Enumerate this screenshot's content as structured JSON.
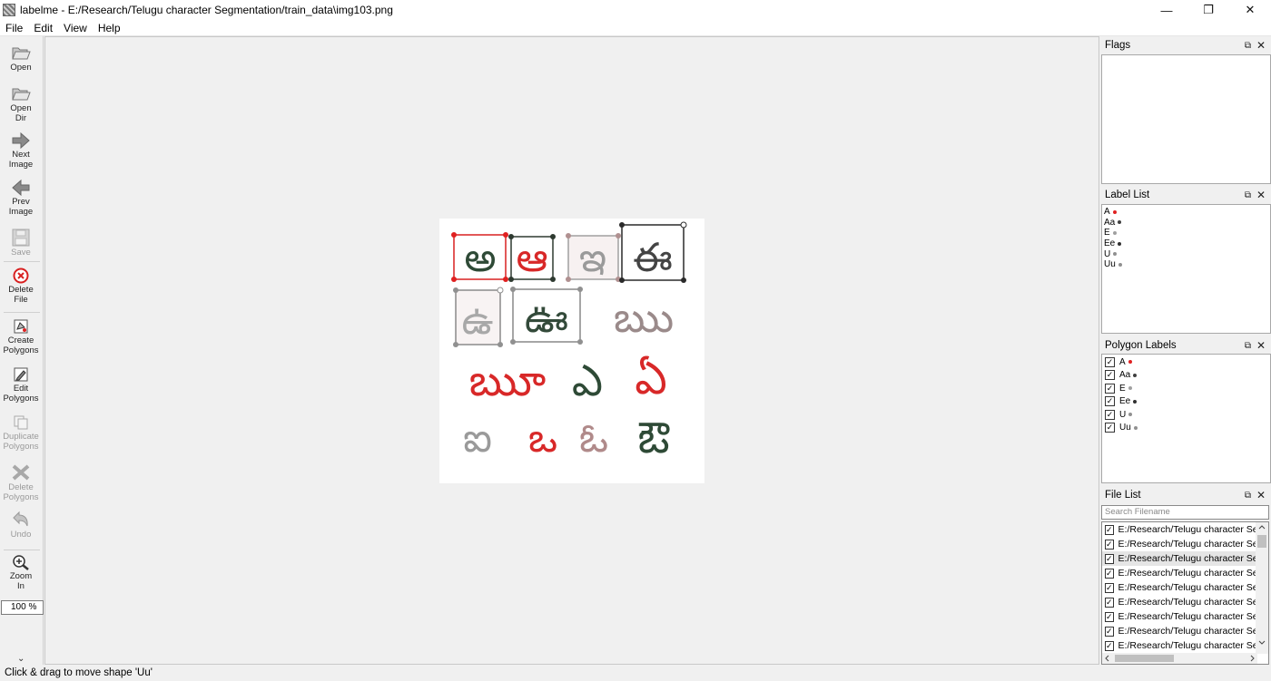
{
  "window": {
    "title": "labelme - E:/Research/Telugu character Segmentation/train_data\\img103.png",
    "minimize": "—",
    "restore": "❐",
    "close": "✕"
  },
  "menu": [
    "File",
    "Edit",
    "View",
    "Help"
  ],
  "toolbar": {
    "open": "Open",
    "open_dir": "Open\nDir",
    "next_image": "Next\nImage",
    "prev_image": "Prev\nImage",
    "save": "Save",
    "delete_file": "Delete\nFile",
    "create_polygons": "Create\nPolygons",
    "edit_polygons": "Edit\nPolygons",
    "duplicate_polygons": "Duplicate\nPolygons",
    "delete_polygons": "Delete\nPolygons",
    "undo": "Undo",
    "zoom_in": "Zoom\nIn",
    "zoom_value": "100 %"
  },
  "canvas": {
    "characters": [
      "అ",
      "ఆ",
      "ఇ",
      "ఈ",
      "ఉ",
      "ఊ",
      "ఋ",
      "ౠ",
      "ఎ",
      "ఏ",
      "ఐ",
      "ఒ",
      "ఓ",
      "ఔ"
    ]
  },
  "flags": {
    "title": "Flags"
  },
  "label_list": {
    "title": "Label List",
    "items": [
      {
        "label": "A",
        "color": "#e02020"
      },
      {
        "label": "Aa",
        "color": "#404040"
      },
      {
        "label": "E",
        "color": "#a0a0a0"
      },
      {
        "label": "Ee",
        "color": "#303030"
      },
      {
        "label": "U",
        "color": "#909090"
      },
      {
        "label": "Uu",
        "color": "#909090"
      }
    ]
  },
  "polygon_labels": {
    "title": "Polygon Labels",
    "items": [
      {
        "label": "A",
        "color": "#e02020"
      },
      {
        "label": "Aa",
        "color": "#404040"
      },
      {
        "label": "E",
        "color": "#a0a0a0"
      },
      {
        "label": "Ee",
        "color": "#303030"
      },
      {
        "label": "U",
        "color": "#909090"
      },
      {
        "label": "Uu",
        "color": "#909090"
      }
    ]
  },
  "file_list": {
    "title": "File List",
    "search_placeholder": "Search Filename",
    "files": [
      "E:/Research/Telugu character Se",
      "E:/Research/Telugu character Se",
      "E:/Research/Telugu character Se",
      "E:/Research/Telugu character Se",
      "E:/Research/Telugu character Se",
      "E:/Research/Telugu character Se",
      "E:/Research/Telugu character Se",
      "E:/Research/Telugu character Se",
      "E:/Research/Telugu character Se"
    ],
    "selected_index": 2
  },
  "status": "Click & drag to move shape 'Uu'",
  "panel_float_icon": "⧉",
  "panel_close_icon": "✕"
}
